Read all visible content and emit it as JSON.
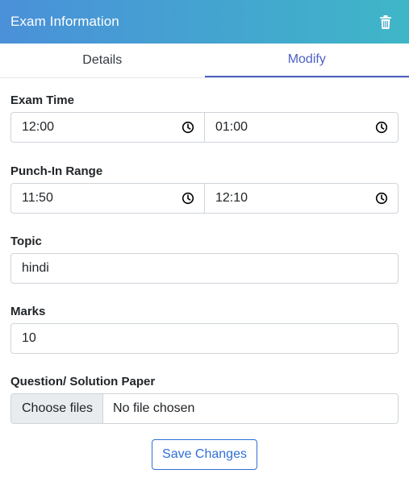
{
  "header": {
    "title": "Exam Information",
    "delete_icon": "trash-icon"
  },
  "tabs": [
    {
      "label": "Details",
      "active": false
    },
    {
      "label": "Modify",
      "active": true
    }
  ],
  "form": {
    "exam_time": {
      "label": "Exam Time",
      "start": "12:00",
      "end": "01:00"
    },
    "punch_in_range": {
      "label": "Punch-In Range",
      "start": "11:50",
      "end": "12:10"
    },
    "topic": {
      "label": "Topic",
      "value": "hindi"
    },
    "marks": {
      "label": "Marks",
      "value": "10"
    },
    "paper": {
      "label": "Question/ Solution Paper",
      "button_label": "Choose files",
      "status": "No file chosen"
    },
    "save_label": "Save Changes"
  },
  "colors": {
    "header_gradient_start": "#4a90d9",
    "header_gradient_end": "#3fb6c8",
    "active_tab": "#4e5fc2",
    "save_button": "#2f6fd6"
  }
}
